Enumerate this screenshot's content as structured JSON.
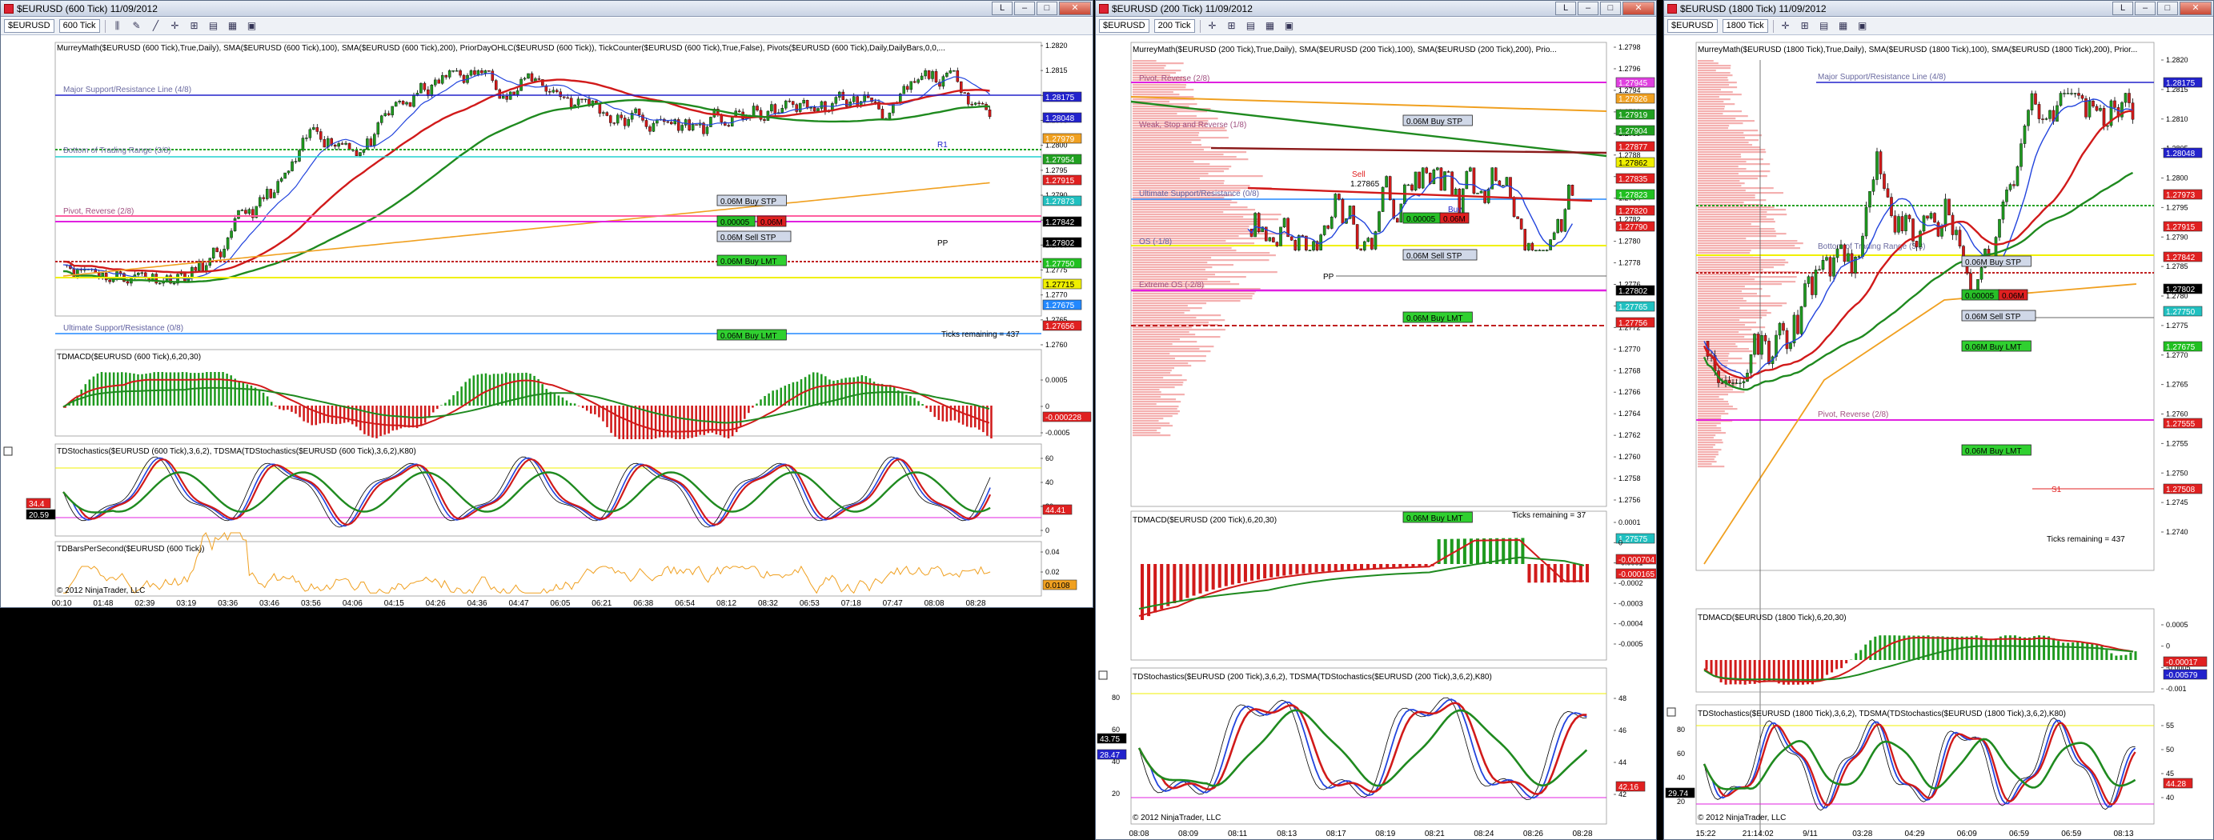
{
  "windows": [
    {
      "id": "w1",
      "title": "$EURUSD (600 Tick)  11/09/2012",
      "symbol": "$EURUSD",
      "interval": "600 Tick",
      "panels": {
        "price": {
          "header": "MurreyMath($EURUSD (600 Tick),True,Daily), SMA($EURUSD (600 Tick),100), SMA($EURUSD (600 Tick),200), PriorDayOHLC($EURUSD (600 Tick)), TickCounter($EURUSD (600 Tick),True,False), Pivots($EURUSD (600 Tick),Daily,DailyBars,0,0,...",
          "ticks": [
            "1.2820",
            "1.2815",
            "1.2810",
            "1.2805",
            "1.2800",
            "1.2795",
            "1.2790",
            "1.2785",
            "1.2780",
            "1.2775",
            "1.2770",
            "1.2765",
            "1.2760"
          ],
          "level_labels": [
            "Major Support/Resistance Line (4/8)",
            "Bottom of Trading Range (3/8)",
            "Pivot, Reverse (2/8)",
            "Ultimate Support/Resistance (0/8)",
            "R1",
            "PP",
            "Ticks remaining = 437"
          ],
          "tags": [
            "1.28175",
            "1.28048",
            "1.27979",
            "1.27954",
            "1.27915",
            "1.27873",
            "1.27842",
            "1.27802",
            "1.27750",
            "1.27715",
            "1.27675",
            "1.27656"
          ],
          "orders": [
            "0.06M  Buy STP",
            "0.00005",
            "0.06M",
            "0.06M  Sell STP",
            "0.06M  Buy LMT",
            "0.06M  Buy LMT"
          ]
        },
        "macd": {
          "header": "TDMACD($EURUSD (600 Tick),6,20,30)",
          "ticks": [
            "0.0005",
            "0",
            "-0.0005"
          ],
          "tag": "-0.000228"
        },
        "stoch": {
          "header": "TDStochastics($EURUSD (600 Tick),3,6,2), TDSMA(TDStochastics($EURUSD (600 Tick),3,6,2),K80)",
          "ticks": [
            "60",
            "40",
            "20",
            "0"
          ],
          "tags_left": [
            "34.4",
            "20.59"
          ],
          "tag_right": "44.41"
        },
        "bps": {
          "header": "TDBarsPerSecond($EURUSD (600 Tick))",
          "ticks": [
            "0.04",
            "0.02"
          ],
          "tag": "0.0108",
          "copyright": "© 2012 NinjaTrader, LLC"
        }
      },
      "time_axis": [
        "00:10",
        "01:48",
        "02:39",
        "03:19",
        "03:36",
        "03:46",
        "03:56",
        "04:06",
        "04:15",
        "04:26",
        "04:36",
        "04:47",
        "06:05",
        "06:21",
        "06:38",
        "06:54",
        "08:12",
        "08:32",
        "06:53",
        "07:18",
        "07:47",
        "08:08",
        "08:28"
      ]
    },
    {
      "id": "w2",
      "title": "$EURUSD (200 Tick)  11/09/2012",
      "symbol": "$EURUSD",
      "interval": "200 Tick",
      "panels": {
        "price": {
          "header": "MurreyMath($EURUSD (200 Tick),True,Daily), SMA($EURUSD (200 Tick),100), SMA($EURUSD (200 Tick),200), Prio...",
          "ticks": [
            "1.2798",
            "1.2796",
            "1.2794",
            "1.2792",
            "1.2790",
            "1.2788",
            "1.2786",
            "1.2784",
            "1.2782",
            "1.2780",
            "1.2778",
            "1.2776",
            "1.2774",
            "1.2772",
            "1.2770",
            "1.2768",
            "1.2766",
            "1.2764",
            "1.2762",
            "1.2760",
            "1.2758",
            "1.2756"
          ],
          "level_labels": [
            "Pivot, Reverse (2/8)",
            "Weak, Stop and Reverse (1/8)",
            "Ultimate Support/Resistance (0/8)",
            "OS (-1/8)",
            "Extreme OS (-2/8)",
            "PP",
            "Sell",
            "1.27865",
            "Buy",
            "Ticks remaining = 37"
          ],
          "tags": [
            "1.27945",
            "1.27926",
            "1.27919",
            "1.27904",
            "1.27877",
            "1.27862",
            "1.27835",
            "1.27823",
            "1.27820",
            "1.27790",
            "1.27802",
            "1.27765",
            "1.27756",
            "1.27575"
          ],
          "orders": [
            "0.06M  Buy STP",
            "0.00005",
            "0.06M",
            "0.06M  Sell STP",
            "0.06M  Buy LMT",
            "0.06M  Buy LMT"
          ]
        },
        "macd": {
          "header": "TDMACD($EURUSD (200 Tick),6,20,30)",
          "ticks": [
            "0.0001",
            "0",
            "-0.0001",
            "-0.0002",
            "-0.0003",
            "-0.0004",
            "-0.0005"
          ],
          "tags": [
            "-0.000704",
            "-0.000165"
          ]
        },
        "stoch": {
          "header": "TDStochastics($EURUSD (200 Tick),3,6,2), TDSMA(TDStochastics($EURUSD (200 Tick),3,6,2),K80)",
          "ticks_left": [
            "80",
            "60",
            "40",
            "20"
          ],
          "ticks_right": [
            "48",
            "46",
            "44",
            "42"
          ],
          "tags_left": [
            "43.75",
            "28.47"
          ],
          "tag_right": "42.16",
          "copyright": "© 2012 NinjaTrader, LLC"
        }
      },
      "time_axis": [
        "08:08",
        "08:09",
        "08:11",
        "08:13",
        "08:17",
        "08:19",
        "08:21",
        "08:24",
        "08:26",
        "08:28"
      ]
    },
    {
      "id": "w3",
      "title": "$EURUSD (1800 Tick)  11/09/2012",
      "symbol": "$EURUSD",
      "interval": "1800 Tick",
      "panels": {
        "price": {
          "header": "MurreyMath($EURUSD (1800 Tick),True,Daily), SMA($EURUSD (1800 Tick),100), SMA($EURUSD (1800 Tick),200), Prior...",
          "ticks": [
            "1.2820",
            "1.2815",
            "1.2810",
            "1.2805",
            "1.2800",
            "1.2795",
            "1.2790",
            "1.2785",
            "1.2780",
            "1.2775",
            "1.2770",
            "1.2765",
            "1.2760",
            "1.2755",
            "1.2750",
            "1.2745",
            "1.2740"
          ],
          "level_labels": [
            "Major Support/Resistance Line (4/8)",
            "Bottom of Trading Range (3/8)",
            "Pivot, Reverse (2/8)",
            "PP",
            "S1",
            "Ticks remaining = 437"
          ],
          "tags": [
            "1.28175",
            "1.28048",
            "1.27973",
            "1.27915",
            "1.27842",
            "1.27802",
            "1.27750",
            "1.27675",
            "1.27555",
            "1.27508"
          ],
          "orders": [
            "0.06M  Buy STP",
            "0.00005",
            "0.06M",
            "0.06M  Sell STP",
            "0.06M  Buy LMT",
            "0.06M  Buy LMT"
          ]
        },
        "macd": {
          "header": "TDMACD($EURUSD (1800 Tick),6,20,30)",
          "ticks": [
            "0.0005",
            "0",
            "-0.0005",
            "-0.001"
          ],
          "tags": [
            "-0.00017",
            "-0.00579"
          ]
        },
        "stoch": {
          "header": "TDStochastics($EURUSD (1800 Tick),3,6,2), TDSMA(TDStochastics($EURUSD (1800 Tick),3,6,2),K80)",
          "ticks_left": [
            "80",
            "60",
            "40",
            "20"
          ],
          "ticks_right": [
            "55",
            "50",
            "45",
            "40"
          ],
          "tags_left": [
            "29.74"
          ],
          "tag_right": "44.28",
          "copyright": "© 2012 NinjaTrader, LLC"
        }
      },
      "time_axis": [
        "15:22",
        "21:14:02",
        "9/11",
        "03:28",
        "04:29",
        "06:09",
        "06:59",
        "06:59",
        "08:13"
      ]
    }
  ],
  "colors": {
    "up": "#1f9a1f",
    "down": "#d11a1a",
    "sma100": "#d11a1a",
    "sma200": "#1f8a1f",
    "ema": "#2244dd",
    "orange": "#f0a020",
    "yellow": "#f0f000",
    "magenta": "#e020e0",
    "blue_line": "#2222cc",
    "green_dot": "#20a020",
    "red_dot": "#c02020",
    "profile": "#f4b0b0"
  }
}
